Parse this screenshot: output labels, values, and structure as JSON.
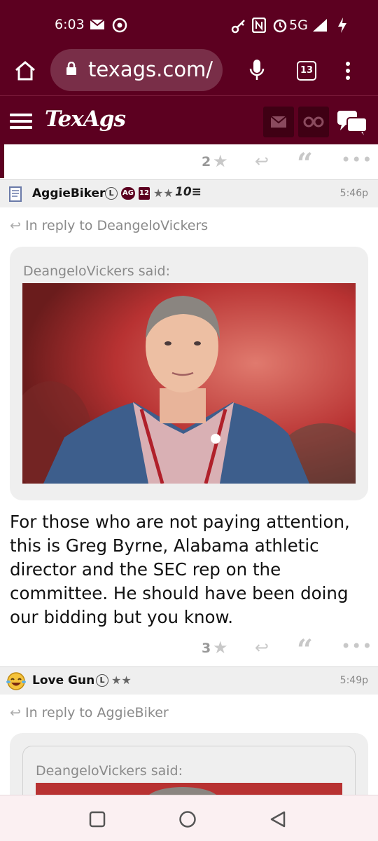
{
  "status_bar": {
    "time": "6:03",
    "network": "5G"
  },
  "browser": {
    "url": "texags.com/",
    "tab_count": "13"
  },
  "site": {
    "logo": "TexAgs"
  },
  "colors": {
    "brand_maroon": "#5c0020",
    "light_gray": "#efefef"
  },
  "prev_post": {
    "star_count": "2"
  },
  "posts": [
    {
      "username": "AggieBiker",
      "badge_l": "L",
      "badge_ag": "AG",
      "badge_12": "12",
      "stars": "★★",
      "badge_10x": "10≡",
      "time": "5:46p",
      "in_reply_to": "In reply to DeangeloVickers",
      "quote_author": "DeangeloVickers said:",
      "body": "For those who are not paying attention, this is Greg Byrne, Alabama athletic director and the SEC rep on the committee. He should have been doing our bidding but you know.",
      "star_count": "3"
    },
    {
      "username": "Love Gun",
      "badge_l": "L",
      "stars": "★★",
      "time": "5:49p",
      "in_reply_to": "In reply to AggieBiker",
      "quote_author": "DeangeloVickers said:"
    }
  ],
  "icons": {
    "reply": "reply-arrow-icon",
    "quote": "quote-icon",
    "more": "more-dots-icon",
    "star": "star-icon"
  }
}
